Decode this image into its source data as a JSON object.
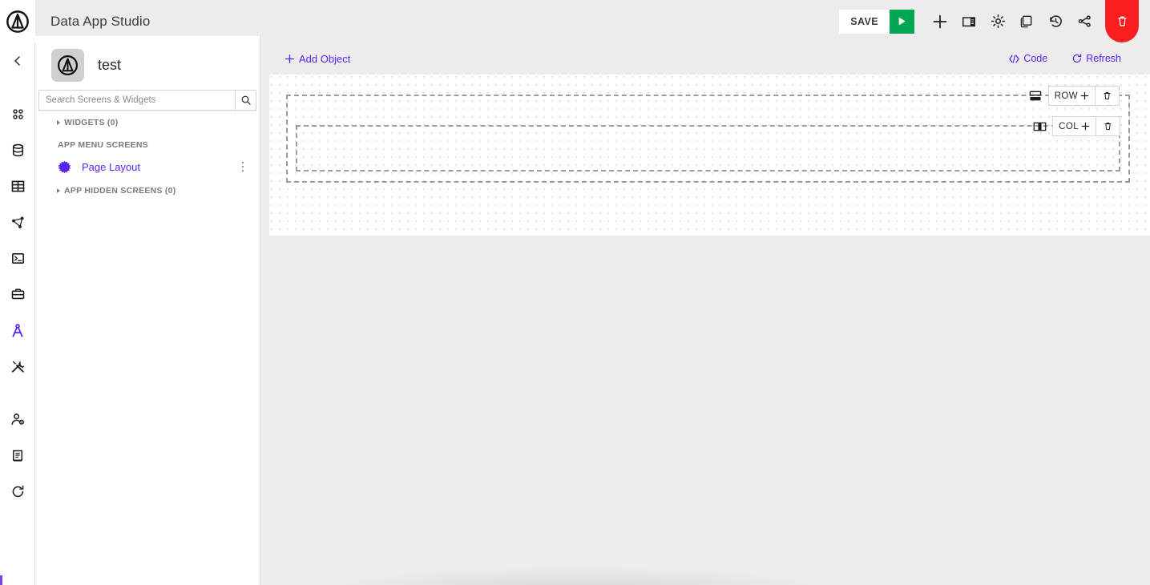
{
  "header": {
    "title": "Data App Studio",
    "logo_icon": "ampersand-circle-logo",
    "save_label": "SAVE",
    "run_icon": "play-icon",
    "tools": [
      {
        "name": "add-icon",
        "label": "Add"
      },
      {
        "name": "panel-layout-icon",
        "label": "Panel"
      },
      {
        "name": "gear-icon",
        "label": "Settings"
      },
      {
        "name": "copy-icon",
        "label": "Duplicate"
      },
      {
        "name": "history-icon",
        "label": "History"
      },
      {
        "name": "branch-icon",
        "label": "Branch"
      }
    ],
    "delete_icon": "trash-icon",
    "accent_green": "#00a651",
    "accent_red": "#fa1e1e"
  },
  "rail": {
    "items": [
      {
        "name": "collapse-chevron-left-icon",
        "active": false
      },
      {
        "name": "apps-grid-icon",
        "active": false
      },
      {
        "name": "database-icon",
        "active": false
      },
      {
        "name": "table-icon",
        "active": false
      },
      {
        "name": "graph-network-icon",
        "active": false
      },
      {
        "name": "terminal-icon",
        "active": false
      },
      {
        "name": "toolbox-icon",
        "active": false
      },
      {
        "name": "compass-icon",
        "active": true
      },
      {
        "name": "tools-icon",
        "active": false
      },
      {
        "name": "user-settings-icon",
        "active": false
      },
      {
        "name": "book-icon",
        "active": false
      },
      {
        "name": "refresh-icon",
        "active": false
      }
    ],
    "accent": "#5724f5"
  },
  "panel": {
    "app_name": "test",
    "app_icon": "ampersand-circle-logo",
    "search": {
      "placeholder": "Search Screens & Widgets",
      "value": "",
      "icon": "search-icon"
    },
    "widgets_section": "WIDGETS (0)",
    "app_menu_screens_label": "APP MENU SCREENS",
    "screens": [
      {
        "name": "Page Layout",
        "icon": "starburst-icon",
        "menu_icon": "kebab-menu-icon"
      }
    ],
    "hidden_section": "APP HIDDEN SCREENS (0)"
  },
  "canvas_toolbar": {
    "add_object_label": "Add Object",
    "add_object_icon": "plus-icon",
    "code_label": "Code",
    "code_icon": "code-brackets-icon",
    "refresh_label": "Refresh",
    "refresh_icon": "refresh-icon"
  },
  "canvas": {
    "row": {
      "handle_icon": "rows-layout-icon",
      "label": "ROW",
      "add_icon": "plus-icon",
      "delete_icon": "trash-icon"
    },
    "column": {
      "handle_icon": "columns-layout-icon",
      "label": "COL",
      "add_icon": "plus-icon",
      "delete_icon": "trash-icon"
    }
  }
}
